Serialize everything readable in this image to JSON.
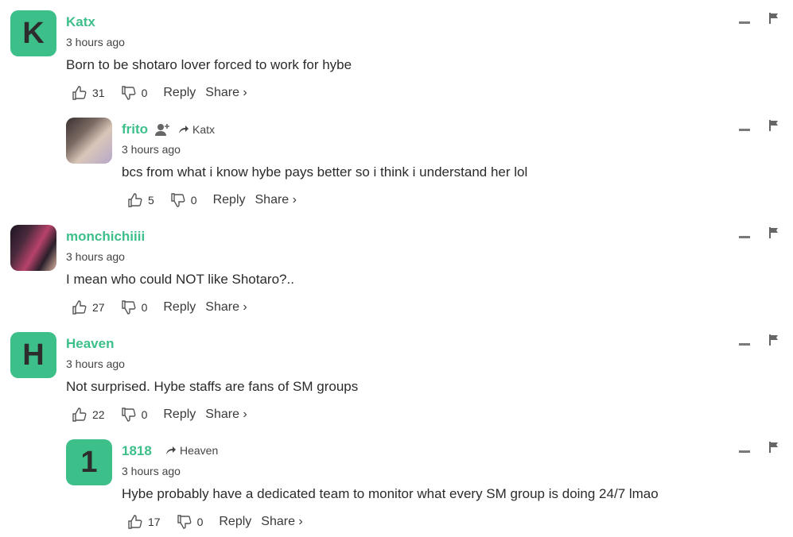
{
  "comments": [
    {
      "avatar": "K",
      "name": "Katx",
      "reply_to": "",
      "time": "3 hours ago",
      "text": "Born to be shotaro lover forced to work for hybe",
      "likes": "31",
      "dislikes": "0"
    },
    {
      "avatar": "",
      "name": "frito",
      "reply_to": "Katx",
      "time": "3 hours ago",
      "text": "bcs from what i know hybe pays better so i think i understand her lol",
      "likes": "5",
      "dislikes": "0"
    },
    {
      "avatar": "",
      "name": "monchichiiii",
      "reply_to": "",
      "time": "3 hours ago",
      "text": "I mean who could NOT like Shotaro?..",
      "likes": "27",
      "dislikes": "0"
    },
    {
      "avatar": "H",
      "name": "Heaven",
      "reply_to": "",
      "time": "3 hours ago",
      "text": "Not surprised. Hybe staffs are fans of SM groups",
      "likes": "22",
      "dislikes": "0"
    },
    {
      "avatar": "1",
      "name": "1818",
      "reply_to": "Heaven",
      "time": "3 hours ago",
      "text": "Hybe probably have a dedicated team to monitor what every SM group is doing 24/7 lmao",
      "likes": "17",
      "dislikes": "0"
    }
  ],
  "labels": {
    "reply": "Reply",
    "share": "Share ›"
  },
  "colors": {
    "accent": "#3dbf8a",
    "text": "#2b2b2b"
  }
}
